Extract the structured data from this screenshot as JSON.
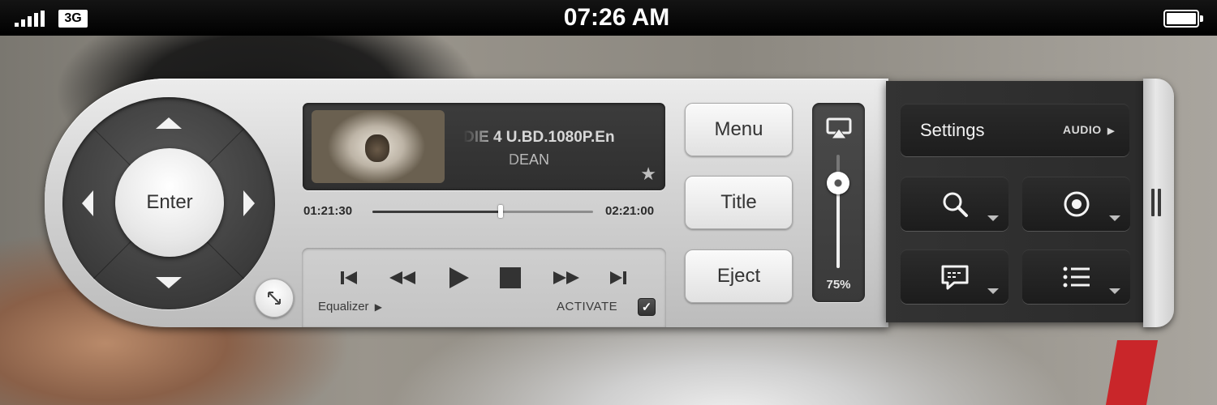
{
  "status_bar": {
    "network": "3G",
    "time": "07:26 AM"
  },
  "remote": {
    "enter_label": "Enter"
  },
  "now_playing": {
    "title": "DIE 4 U.BD.1080P.En",
    "subtitle": "DEAN",
    "elapsed": "01:21:30",
    "total": "02:21:00",
    "progress": 0.58
  },
  "transport": {
    "equalizer_label": "Equalizer",
    "activate_label": "ACTIVATE",
    "activate_checked": true
  },
  "side_buttons": {
    "menu": "Menu",
    "title": "Title",
    "eject": "Eject"
  },
  "volume": {
    "level": 0.75,
    "label": "75%"
  },
  "settings": {
    "title": "Settings",
    "mode": "AUDIO"
  },
  "icons": {
    "grid": [
      "search-icon",
      "record-icon",
      "subtitles-icon",
      "list-icon"
    ]
  },
  "colors": {
    "panel_light": "#d3d3d3",
    "panel_dark": "#2b2b2b",
    "accent_text": "#333333"
  }
}
